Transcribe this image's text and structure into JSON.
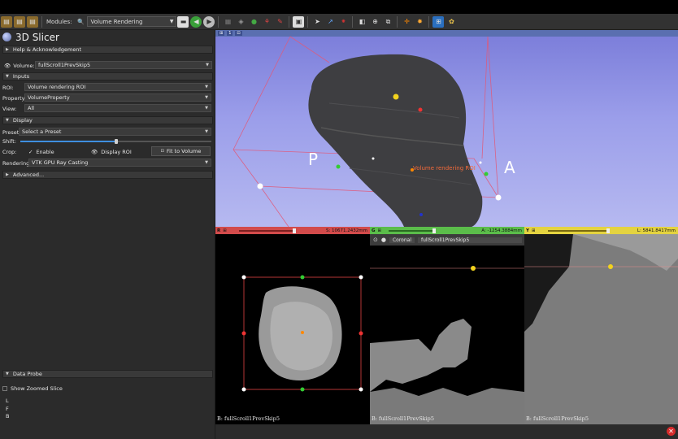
{
  "toolbar": {
    "modules_label": "Modules:",
    "module_selected": "Volume Rendering"
  },
  "app": {
    "title": "3D Slicer"
  },
  "sections": {
    "help": "Help & Acknowledgement",
    "inputs": "Inputs",
    "display": "Display",
    "advanced": "Advanced...",
    "data_probe": "Data Probe"
  },
  "volume": {
    "label": "Volume:",
    "value": "fullScroll1PrevSkip5"
  },
  "inputs": {
    "roi_label": "ROI:",
    "roi_value": "Volume rendering ROI",
    "property_label": "Property:",
    "property_value": "VolumeProperty",
    "view_label": "View:",
    "view_value": "All"
  },
  "display": {
    "preset_label": "Preset:",
    "preset_value": "Select a Preset",
    "shift_label": "Shift:",
    "shift_level": 0.5,
    "crop_label": "Crop:",
    "enable_label": "Enable",
    "enable_checked": true,
    "display_roi_label": "Display ROI",
    "fit_button": "Fit to Volume",
    "rendering_label": "Rendering:",
    "rendering_value": "VTK GPU Ray Casting"
  },
  "data_probe": {
    "show_zoomed": "Show Zoomed Slice",
    "l": "L",
    "f": "F",
    "b": "B"
  },
  "view3d": {
    "view_number": "1",
    "label_p": "P",
    "label_a": "A",
    "roi_label": "Volume rendering ROI"
  },
  "slice_red": {
    "letter": "R",
    "offset": "S: 10671.2432mm",
    "caption": "B: fullScroll1PrevSkip5"
  },
  "slice_green": {
    "letter": "G",
    "offset": "A: -1254.3884mm",
    "orientation": "Coronal",
    "volume": "fullScroll1PrevSkip5",
    "caption": "B: fullScroll1PrevSkip5"
  },
  "slice_yellow": {
    "letter": "Y",
    "offset": "L: 5841.8417mm",
    "caption": "B: fullScroll1PrevSkip5"
  },
  "colors": {
    "red": "#e13b3b",
    "green": "#4cbb3e",
    "yellow": "#e8d23a",
    "accent": "#3f8fe0"
  }
}
